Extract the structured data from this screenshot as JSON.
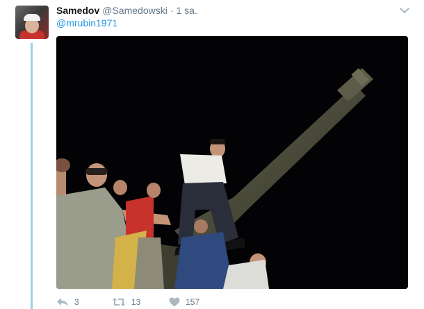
{
  "tweet": {
    "display_name": "Samedov",
    "username": "@Samedowski",
    "separator": "·",
    "timestamp": "1 sa.",
    "mention": "@mrubin1971"
  },
  "actions": {
    "reply_count": "3",
    "retweet_count": "13",
    "like_count": "157"
  },
  "icons": {
    "chevron": "chevron-down-icon",
    "reply": "reply-icon",
    "retweet": "retweet-icon",
    "like": "heart-icon"
  },
  "colors": {
    "link": "#1b95e0",
    "muted": "#657786",
    "thread_line": "#9ad1ea",
    "text": "#14171a"
  }
}
